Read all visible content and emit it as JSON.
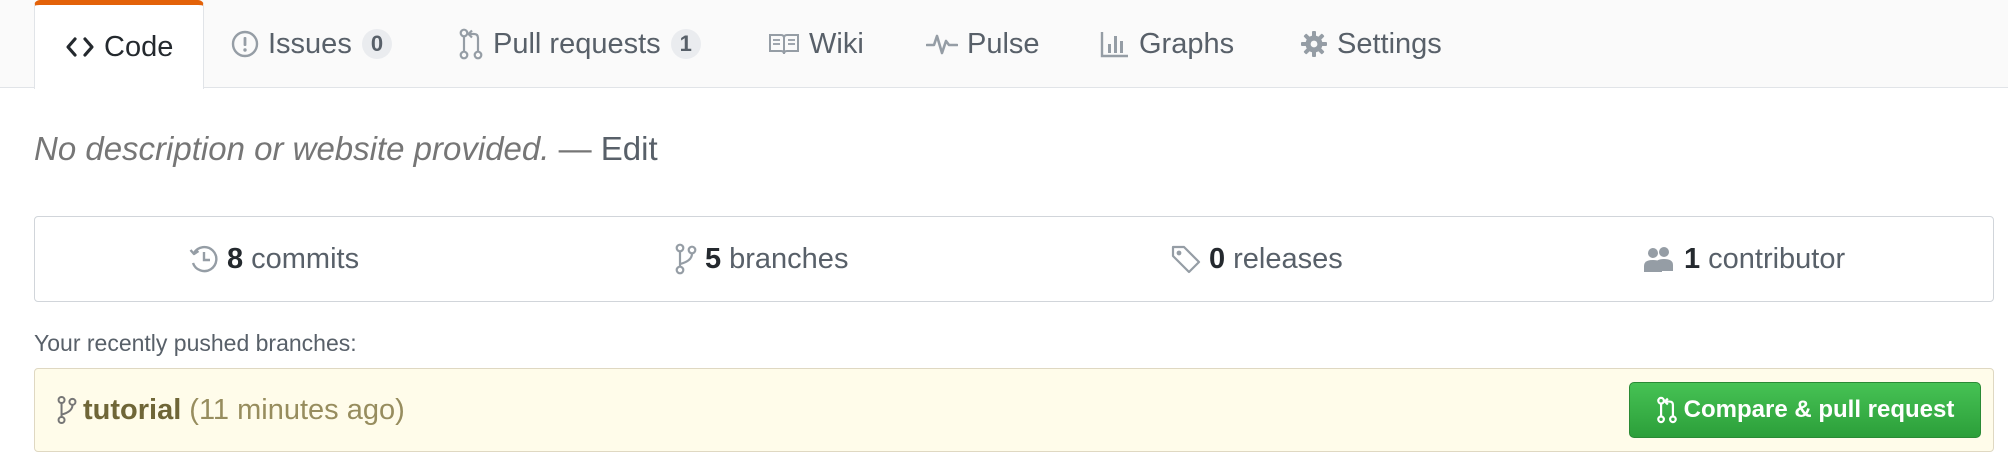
{
  "tabs": [
    {
      "label": "Code",
      "icon": "code-icon",
      "active": true
    },
    {
      "label": "Issues",
      "icon": "issue-opened-icon",
      "count": "0"
    },
    {
      "label": "Pull requests",
      "icon": "git-pull-request-icon",
      "count": "1"
    },
    {
      "label": "Wiki",
      "icon": "book-icon"
    },
    {
      "label": "Pulse",
      "icon": "pulse-icon"
    },
    {
      "label": "Graphs",
      "icon": "graph-icon"
    },
    {
      "label": "Settings",
      "icon": "gear-icon"
    }
  ],
  "description": {
    "text": "No description or website provided.",
    "separator": " — ",
    "edit_label": "Edit"
  },
  "summary": {
    "commits": {
      "count": "8",
      "label": "commits",
      "icon": "history-icon"
    },
    "branches": {
      "count": "5",
      "label": "branches",
      "icon": "git-branch-icon"
    },
    "releases": {
      "count": "0",
      "label": "releases",
      "icon": "tag-icon"
    },
    "contributors": {
      "count": "1",
      "label": "contributor",
      "icon": "people-icon"
    }
  },
  "recent": {
    "label": "Your recently pushed branches:",
    "branch": "tutorial",
    "time": "(11 minutes ago)",
    "button_label": "Compare & pull request"
  },
  "colors": {
    "active_tab_accent": "#e36209",
    "button_green": "#2c9f3a",
    "recent_bg": "#fffcea"
  }
}
